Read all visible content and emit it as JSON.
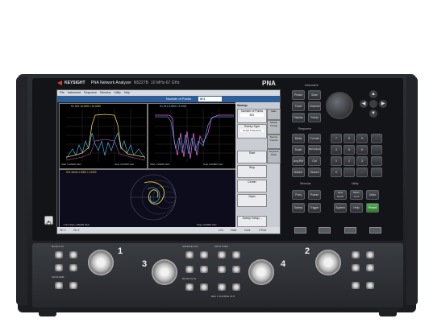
{
  "brand": {
    "logo_text": "KEYSIGHT",
    "model_title": "PNA Network Analyzer",
    "model_number": "N5227B",
    "freq_range": "10 MHz-67 GHz"
  },
  "instrument_label": "PNA",
  "screen": {
    "menu": [
      "File",
      "Instrument",
      "Response",
      "Stimulus",
      "Utility",
      "Help"
    ],
    "toolbar": {
      "label": "Number of Points",
      "value": "801"
    },
    "traces": [
      {
        "header": "S1  S21 10.0000 / 10.0000",
        "footer_left": "Start 1.00000 GHz",
        "footer_right": "Stop 3.00000 GHz"
      },
      {
        "header": "S1  S11 5.0000 / 5.0000",
        "footer_left": "Start 1.00000 GHz",
        "footer_right": "Stop 3.00000 GHz"
      },
      {
        "header": "S11 Smith 1.0000 / 1.0000",
        "footer_left": ">Ch1  Start 1.00000 GHz",
        "footer_right": "Stop 3.00000 GHz"
      }
    ],
    "softkeys": {
      "title": "Sweep",
      "items": [
        "Number of Points",
        "801",
        "Sweep Type",
        "Linear Frequency",
        "Start",
        "Stop",
        "Center",
        "Span",
        "Sweep Setup..."
      ],
      "tabs": [
        "Main",
        "Sweep Timing",
        "Source Control",
        "Segment Table"
      ]
    },
    "status": [
      "Ch 1",
      "Ch 2",
      "LCL",
      "Hold",
      "Cont",
      "2 Port"
    ]
  },
  "hardkeys": {
    "instrument_label": "Instrument",
    "instrument": [
      "Preset",
      "Save",
      "Trace",
      "Channel",
      "Display",
      "Setup"
    ],
    "response_label": "Response",
    "response": [
      "Meas",
      "Format",
      "Scale",
      "Mkr/Analysis",
      "Avg BW",
      "Cal",
      "Marker",
      "Search"
    ],
    "entry": [
      "7",
      "8",
      "9",
      "4",
      "5",
      "6",
      "1",
      "2",
      "3",
      "0",
      ".",
      "-"
    ],
    "stimulus_label": "Stimulus",
    "stimulus": [
      "Freq",
      "Power",
      "Sweep",
      "Trigger"
    ],
    "utility_label": "Utility",
    "utility": [
      "Save Recall",
      "Macro Cond",
      "Undo",
      "System",
      "Help",
      "Preset"
    ]
  },
  "ports": {
    "labels": [
      "1",
      "2",
      "3",
      "4"
    ],
    "jumper_labels": [
      "RCVR A IN",
      "CPLR ARM",
      "SOURCE OUT",
      "CPLR THRU",
      "RCVR R1 IN",
      "REF 1 SOURCE OUT"
    ]
  }
}
